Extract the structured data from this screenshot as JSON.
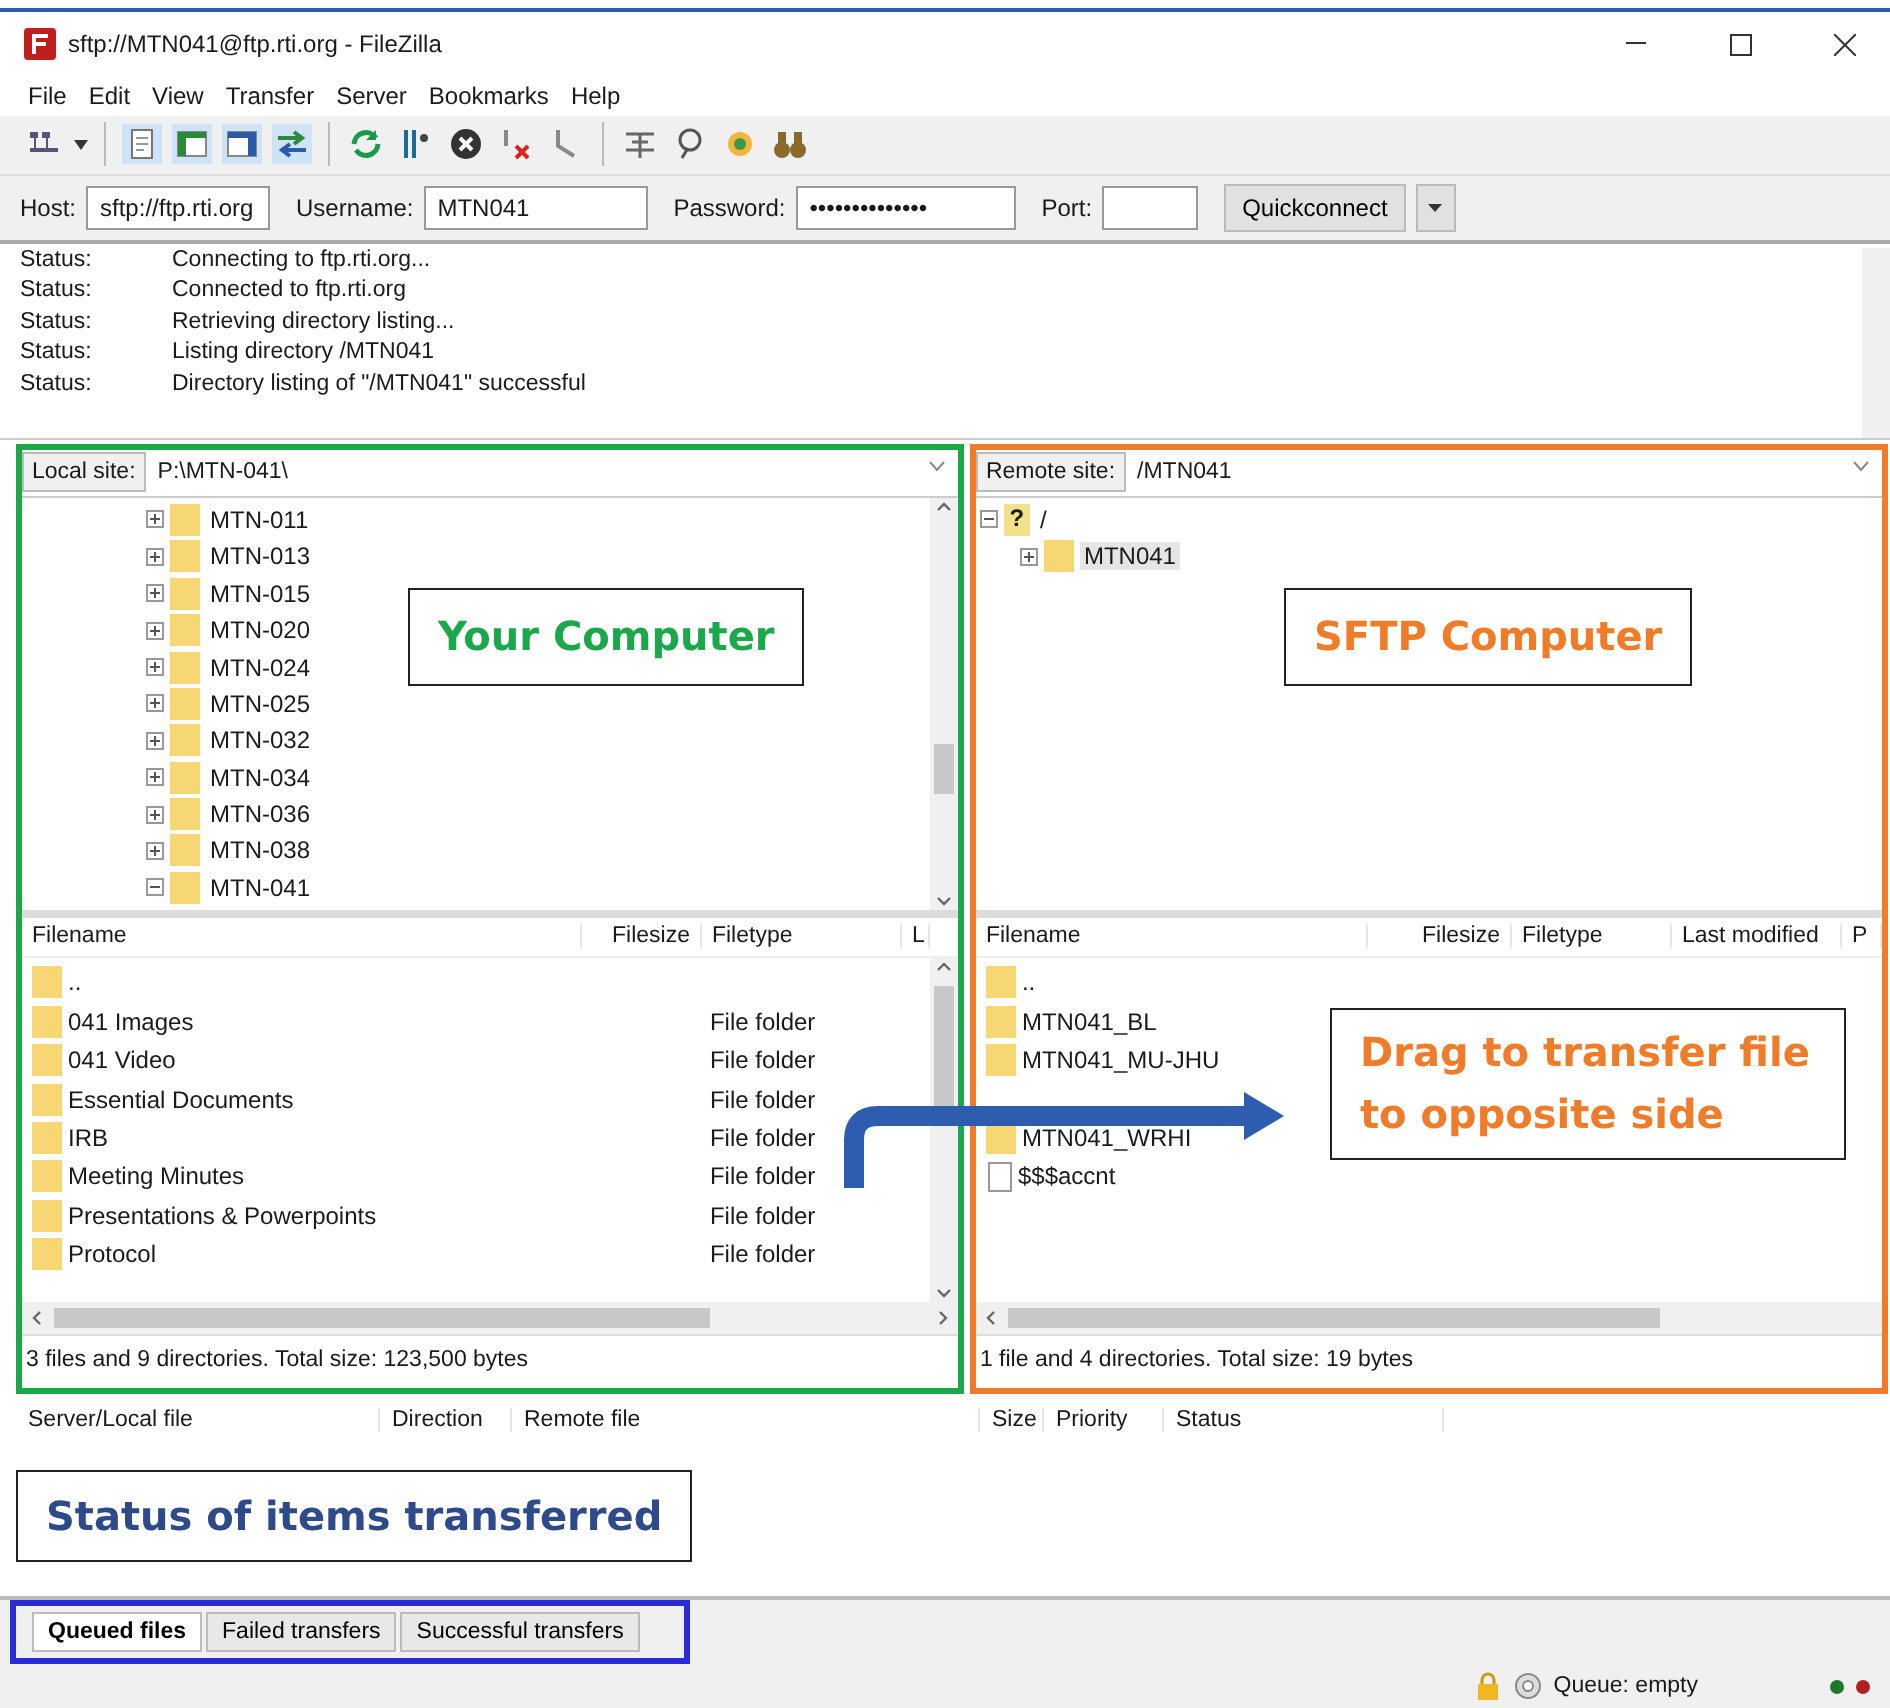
{
  "window": {
    "title": "sftp://MTN041@ftp.rti.org - FileZilla"
  },
  "menu": [
    "File",
    "Edit",
    "View",
    "Transfer",
    "Server",
    "Bookmarks",
    "Help"
  ],
  "quickconnect": {
    "host_label": "Host:",
    "host": "sftp://ftp.rti.org",
    "username_label": "Username:",
    "username": "MTN041",
    "password_label": "Password:",
    "password": "••••••••••••••",
    "port_label": "Port:",
    "button": "Quickconnect"
  },
  "log": [
    {
      "label": "Status:",
      "message": "Connecting to ftp.rti.org..."
    },
    {
      "label": "Status:",
      "message": "Connected to ftp.rti.org"
    },
    {
      "label": "Status:",
      "message": "Retrieving directory listing..."
    },
    {
      "label": "Status:",
      "message": "Listing directory /MTN041"
    },
    {
      "label": "Status:",
      "message": "Directory listing of \"/MTN041\" successful"
    }
  ],
  "panes": [
    {
      "kind": "local",
      "color": "#1aa84a",
      "site_label": "Local site:",
      "path": "P:\\MTN-041\\",
      "tree": [
        {
          "label": "MTN-011",
          "expanded": false
        },
        {
          "label": "MTN-013",
          "expanded": false
        },
        {
          "label": "MTN-015",
          "expanded": false
        },
        {
          "label": "MTN-020",
          "expanded": false
        },
        {
          "label": "MTN-024",
          "expanded": false
        },
        {
          "label": "MTN-025",
          "expanded": false
        },
        {
          "label": "MTN-032",
          "expanded": false
        },
        {
          "label": "MTN-034",
          "expanded": false
        },
        {
          "label": "MTN-036",
          "expanded": false
        },
        {
          "label": "MTN-038",
          "expanded": false
        },
        {
          "label": "MTN-041",
          "expanded": true
        }
      ],
      "columns": [
        "Filename",
        "Filesize",
        "Filetype",
        "L"
      ],
      "rows": [
        {
          "kind": "folder",
          "name": ".."
        },
        {
          "kind": "folder",
          "name": "041 Images",
          "type": "File folder"
        },
        {
          "kind": "folder",
          "name": "041 Video",
          "type": "File folder"
        },
        {
          "kind": "folder",
          "name": "Essential Documents",
          "type": "File folder"
        },
        {
          "kind": "folder",
          "name": "IRB",
          "type": "File folder"
        },
        {
          "kind": "folder",
          "name": "Meeting Minutes",
          "type": "File folder"
        },
        {
          "kind": "folder",
          "name": "Presentations & Powerpoints",
          "type": "File folder"
        },
        {
          "kind": "folder",
          "name": "Protocol",
          "type": "File folder"
        }
      ],
      "summary": "3 files and 9 directories. Total size: 123,500 bytes"
    },
    {
      "kind": "remote",
      "color": "#f07c2a",
      "site_label": "Remote site:",
      "path": "/MTN041",
      "tree": [
        {
          "label": "/",
          "kind": "unknown",
          "badge": "?",
          "expanded": true,
          "children": [
            {
              "label": "MTN041",
              "expanded": false
            }
          ]
        }
      ],
      "columns": [
        "Filename",
        "Filesize",
        "Filetype",
        "Last modified",
        "P"
      ],
      "rows": [
        {
          "kind": "folder",
          "name": ".."
        },
        {
          "kind": "folder",
          "name": "MTN041_BL"
        },
        {
          "kind": "folder",
          "name": "MTN041_MU-JHU"
        },
        {
          "kind": "covered"
        },
        {
          "kind": "folder",
          "name": "MTN041_WRHI"
        },
        {
          "kind": "file",
          "name": "$$$accnt"
        }
      ],
      "summary": "1 file and 4 directories. Total size: 19 bytes"
    }
  ],
  "queue": {
    "columns": [
      "Server/Local file",
      "Direction",
      "Remote file",
      "Size",
      "Priority",
      "Status"
    ]
  },
  "tabs": [
    {
      "label": "Queued files",
      "selected": true
    },
    {
      "label": "Failed transfers",
      "selected": false
    },
    {
      "label": "Successful transfers",
      "selected": false
    }
  ],
  "status_bar": {
    "queue": "Queue: empty"
  },
  "annotations": [
    {
      "kind": "label",
      "text": "Your Computer",
      "color": "#1aa84a"
    },
    {
      "kind": "label",
      "text": "SFTP Computer",
      "color": "#f07c2a"
    },
    {
      "kind": "callout",
      "text": "Drag to transfer file to opposite side",
      "color": "#f07c2a"
    },
    {
      "kind": "label",
      "text": "Status of items transferred",
      "color": "#2e4a8a"
    }
  ],
  "tabs_highlight": {
    "color": "#2a2ad8"
  }
}
